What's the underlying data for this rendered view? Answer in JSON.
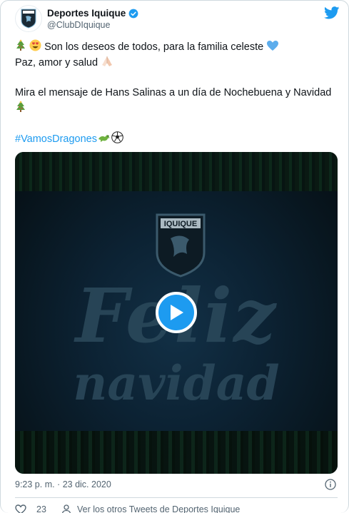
{
  "tweet": {
    "author_name": "Deportes Iquique",
    "author_handle": "@ClubDIquique",
    "line1_text": " Son los deseos de todos, para la familia celeste ",
    "line2_text": "Paz, amor y salud ",
    "line3_text": "Mira el mensaje de Hans Salinas a un día de Nochebuena y Navidad ",
    "hashtag": "#VamosDragones",
    "timestamp": "9:23 p. m. · 23 dic. 2020",
    "likes_count": "23",
    "more_tweets_label": "Ver los otros Tweets de Deportes Iquique"
  },
  "video": {
    "crest_text": "IQUIQUE",
    "line1": "Feliz",
    "line2": "navidad"
  },
  "colors": {
    "accent": "#1d9bf0",
    "text": "#0f1419",
    "muted": "#536471"
  }
}
